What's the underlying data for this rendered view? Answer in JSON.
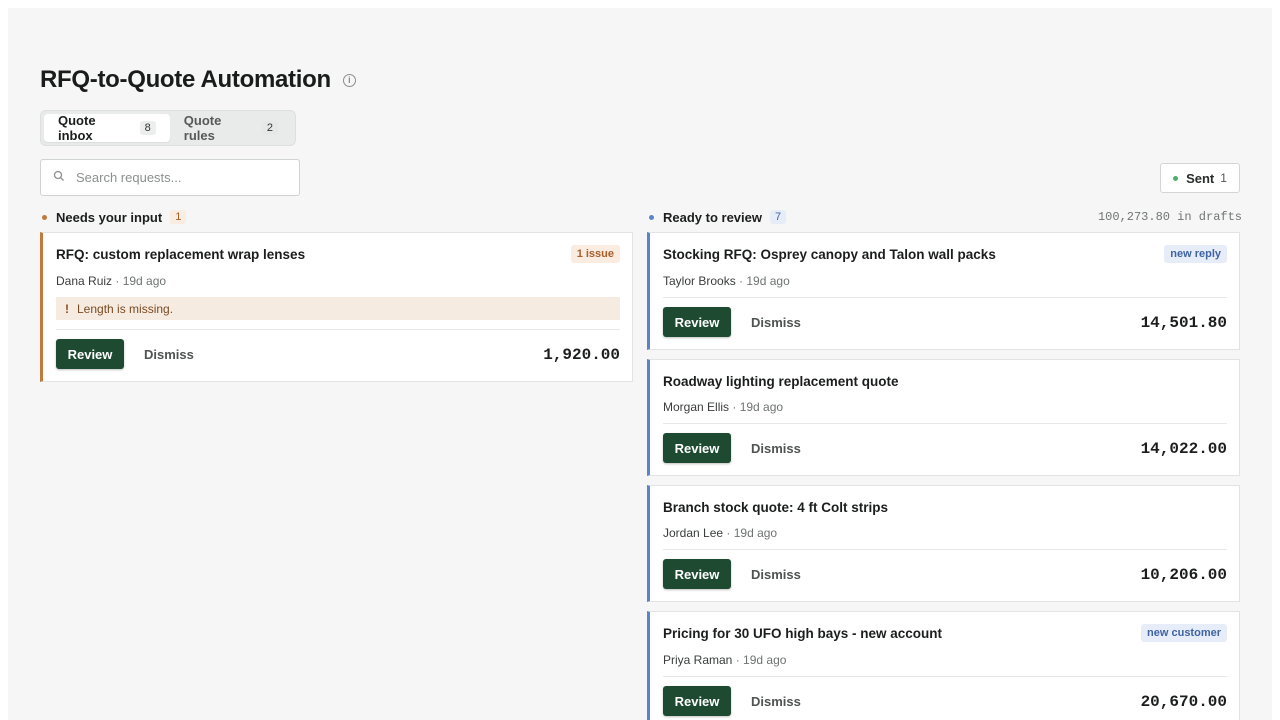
{
  "page": {
    "title": "RFQ-to-Quote Automation",
    "info_icon": "i"
  },
  "tabs": [
    {
      "label": "Quote inbox",
      "count": "8",
      "active": true
    },
    {
      "label": "Quote rules",
      "count": "2",
      "active": false
    }
  ],
  "search": {
    "placeholder": "Search requests..."
  },
  "sent": {
    "label": "Sent",
    "count": "1",
    "dot_color": "#4caf6e"
  },
  "columns": {
    "needs_input": {
      "label": "Needs your input",
      "count": "1",
      "accent": "#c07a3c",
      "cards": [
        {
          "title": "RFQ: custom replacement wrap lenses",
          "requester": "Dana Ruiz",
          "age": "· 19d ago",
          "badge": "1 issue",
          "issue_icon": "!",
          "issue_text": "Length is missing.",
          "review_label": "Review",
          "dismiss_label": "Dismiss",
          "amount": "1,920.00"
        }
      ]
    },
    "ready": {
      "label": "Ready to review",
      "count": "7",
      "accent": "#5b84c8",
      "drafts_total": "100,273.80 in drafts",
      "cards": [
        {
          "title": "Stocking RFQ: Osprey canopy and Talon wall packs",
          "requester": "Taylor Brooks",
          "age": "· 19d ago",
          "badge": "new reply",
          "review_label": "Review",
          "dismiss_label": "Dismiss",
          "amount": "14,501.80"
        },
        {
          "title": "Roadway lighting replacement quote",
          "requester": "Morgan Ellis",
          "age": "· 19d ago",
          "badge": "",
          "review_label": "Review",
          "dismiss_label": "Dismiss",
          "amount": "14,022.00"
        },
        {
          "title": "Branch stock quote: 4 ft Colt strips",
          "requester": "Jordan Lee",
          "age": "· 19d ago",
          "badge": "",
          "review_label": "Review",
          "dismiss_label": "Dismiss",
          "amount": "10,206.00"
        },
        {
          "title": "Pricing for 30 UFO high bays - new account",
          "requester": "Priya Raman",
          "age": "· 19d ago",
          "badge": "new customer",
          "review_label": "Review",
          "dismiss_label": "Dismiss",
          "amount": "20,670.00"
        }
      ]
    }
  }
}
